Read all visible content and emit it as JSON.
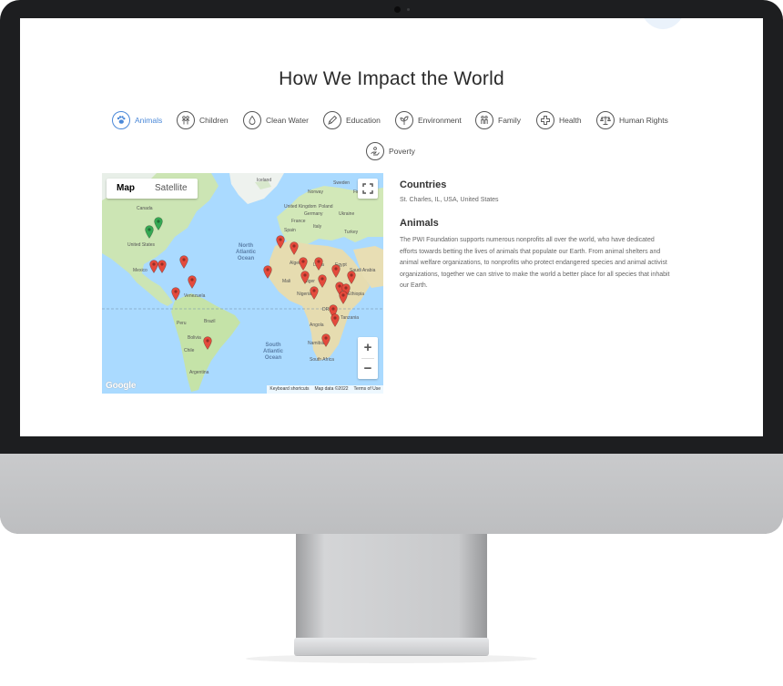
{
  "page": {
    "title": "How We Impact the World",
    "categories": [
      {
        "label": "Animals",
        "icon": "paw-icon",
        "active": true
      },
      {
        "label": "Children",
        "icon": "children-icon",
        "active": false
      },
      {
        "label": "Clean Water",
        "icon": "water-drop-icon",
        "active": false
      },
      {
        "label": "Education",
        "icon": "pencil-icon",
        "active": false
      },
      {
        "label": "Environment",
        "icon": "leaf-icon",
        "active": false
      },
      {
        "label": "Family",
        "icon": "family-icon",
        "active": false
      },
      {
        "label": "Health",
        "icon": "medical-cross-icon",
        "active": false
      },
      {
        "label": "Human Rights",
        "icon": "scales-icon",
        "active": false
      },
      {
        "label": "Poverty",
        "icon": "hand-coin-icon",
        "active": false
      }
    ],
    "accent_color": "#4a88d8"
  },
  "map": {
    "type_controls": {
      "map": "Map",
      "satellite": "Satellite",
      "selected": "Map"
    },
    "zoom_in": "+",
    "zoom_out": "−",
    "logo": "Google",
    "attribution": {
      "shortcuts": "Keyboard shortcuts",
      "data": "Map data ©2022",
      "terms": "Terms of Use"
    },
    "labels": {
      "canada": "Canada",
      "united_states": "United States",
      "mexico": "Mexico",
      "venezuela": "Venezuela",
      "peru": "Peru",
      "brazil": "Brazil",
      "bolivia": "Bolivia",
      "chile": "Chile",
      "argentina": "Argentina",
      "iceland": "Iceland",
      "sweden": "Sweden",
      "norway": "Norway",
      "finland": "Finland",
      "united_kingdom": "United Kingdom",
      "poland": "Poland",
      "germany": "Germany",
      "ukraine": "Ukraine",
      "france": "France",
      "spain": "Spain",
      "italy": "Italy",
      "turkey": "Turkey",
      "algeria": "Algeria",
      "libya": "Libya",
      "egypt": "Egypt",
      "saudi_arabia": "Saudi Arabia",
      "mali": "Mali",
      "niger": "Niger",
      "nigeria": "Nigeria",
      "ethiopia": "Ethiopia",
      "drc": "DRC",
      "tanzania": "Tanzania",
      "angola": "Angola",
      "namibia": "Namibia",
      "south_africa": "South Africa",
      "north_atlantic_1": "North",
      "north_atlantic_2": "Atlantic",
      "north_atlantic_3": "Ocean",
      "south_atlantic_1": "South",
      "south_atlantic_2": "Atlantic",
      "south_atlantic_3": "Ocean"
    },
    "marker_colors": {
      "red": "#e44a3c",
      "green": "#34a853"
    }
  },
  "info": {
    "countries_heading": "Countries",
    "countries_text": "St. Charles, IL, USA, United States",
    "category_heading": "Animals",
    "category_text": "The PWI Foundation supports numerous nonprofits all over the world, who have dedicated efforts towards betting the lives of animals that populate our Earth. From animal shelters and animal welfare organizations, to nonprofits who protect endangered species and animal activist organizations, together we can strive to make the world a better place for all species that inhabit our Earth."
  }
}
